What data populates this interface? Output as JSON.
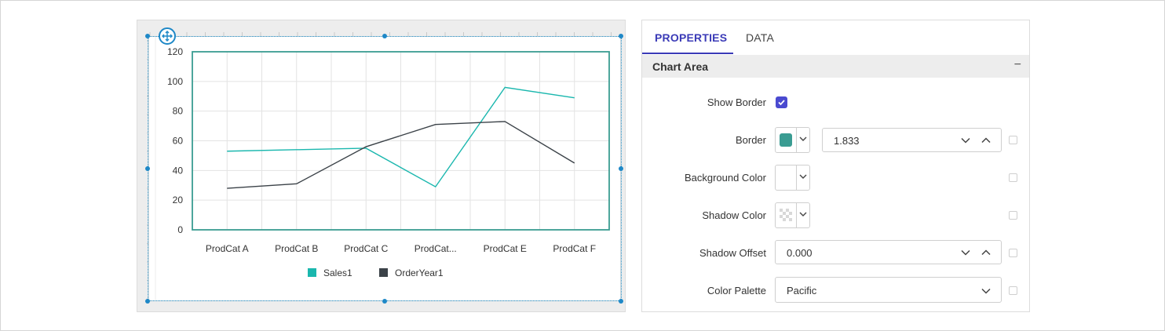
{
  "tabs": {
    "properties": "PROPERTIES",
    "data": "DATA"
  },
  "section": {
    "title": "Chart Area",
    "collapse_glyph": "−"
  },
  "properties": {
    "show_border": {
      "label": "Show Border",
      "checked": true
    },
    "border": {
      "label": "Border",
      "color": "#3a9c92",
      "width_value": "1.833"
    },
    "background_color": {
      "label": "Background Color",
      "color": "#ffffff"
    },
    "shadow_color": {
      "label": "Shadow Color",
      "color": "transparent-checker"
    },
    "shadow_offset": {
      "label": "Shadow Offset",
      "value": "0.000"
    },
    "color_palette": {
      "label": "Color Palette",
      "value": "Pacific"
    }
  },
  "colors": {
    "accent": "#3b3bb7",
    "selection": "#1e88c7",
    "plot_border": "#3a9c92"
  },
  "chart_data": {
    "type": "line",
    "categories": [
      "ProdCat A",
      "ProdCat B",
      "ProdCat C",
      "ProdCat...",
      "ProdCat E",
      "ProdCat F"
    ],
    "ylim": [
      0,
      120
    ],
    "yticks": [
      "0",
      "20",
      "40",
      "60",
      "80",
      "100",
      "120"
    ],
    "grid": true,
    "legend_position": "bottom",
    "series": [
      {
        "name": "Sales1",
        "color": "#1ab7ae",
        "values": [
          53,
          54,
          55,
          29,
          96,
          89
        ]
      },
      {
        "name": "OrderYear1",
        "color": "#3b4248",
        "values": [
          28,
          31,
          56,
          71,
          73,
          45
        ]
      }
    ]
  }
}
